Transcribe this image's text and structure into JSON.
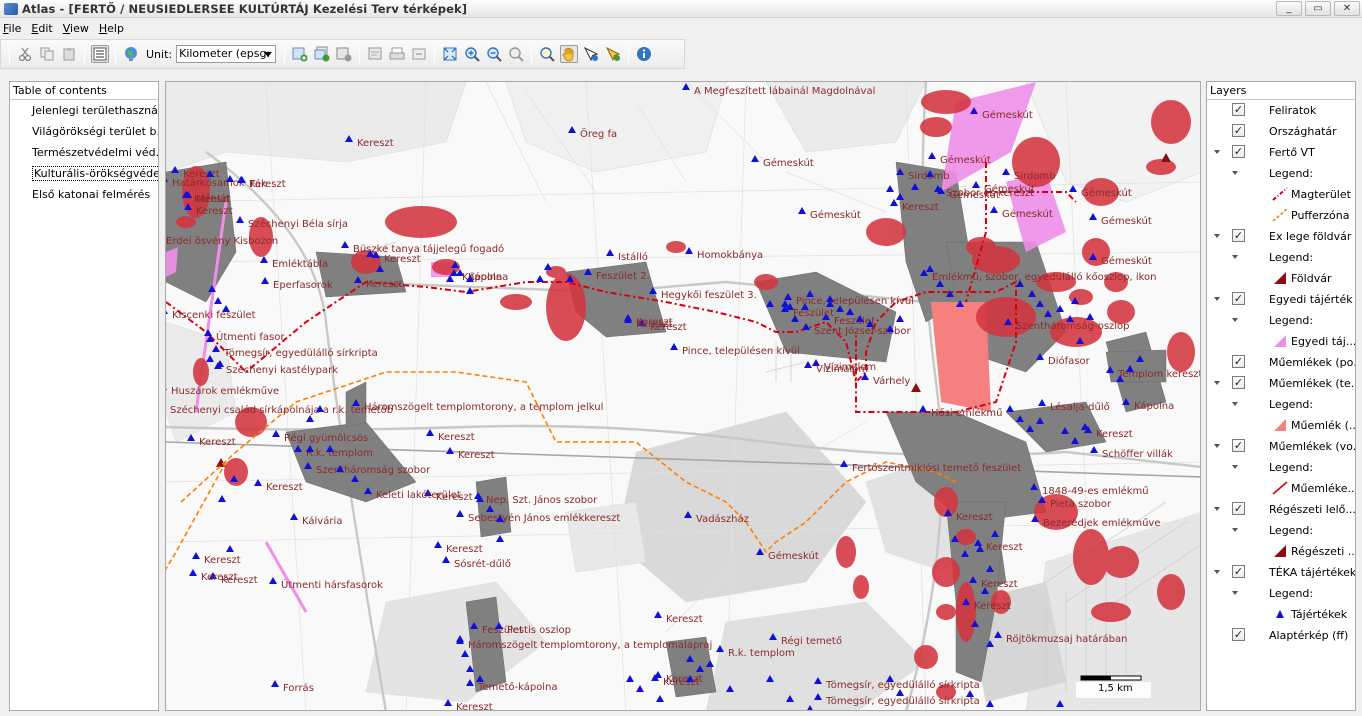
{
  "window": {
    "title": "Atlas - [FERTŐ / NEUSIEDLERSEE KULTÚRTÁJ Kezelési Terv térképek]",
    "controls": [
      "_",
      "▭",
      "✕"
    ]
  },
  "menu": [
    "File",
    "Edit",
    "View",
    "Help"
  ],
  "toolbar": {
    "unit_label": "Unit:",
    "unit_value": "Kilometer (epsg:"
  },
  "toc": {
    "title": "Table of contents",
    "items": [
      "Jelenlegi területhaszná...",
      "Világörökségi terület  b...",
      "Természetvédelmi véd...",
      "Kulturális-örökségvédelem",
      "Első katonai felmérés"
    ],
    "selected_index": 3
  },
  "layers": {
    "title": "Layers",
    "rows": [
      {
        "kind": "layer",
        "name": "Feliratok",
        "expandable": false
      },
      {
        "kind": "layer",
        "name": "Országhatár",
        "expandable": false
      },
      {
        "kind": "layer",
        "name": "Fertő VT",
        "expandable": true
      },
      {
        "kind": "legend",
        "name": "Legend:"
      },
      {
        "kind": "item",
        "name": "Magterület",
        "symbol": "dashdot-red"
      },
      {
        "kind": "item",
        "name": "Pufferzóna",
        "symbol": "dash-orange"
      },
      {
        "kind": "layer",
        "name": "Ex lege földvár",
        "expandable": true
      },
      {
        "kind": "legend",
        "name": "Legend:"
      },
      {
        "kind": "item",
        "name": "Földvár",
        "symbol": "tri-darkred"
      },
      {
        "kind": "layer",
        "name": "Egyedi tájérték",
        "expandable": true
      },
      {
        "kind": "legend",
        "name": "Legend:"
      },
      {
        "kind": "item",
        "name": "Egyedi táj...",
        "symbol": "tri-pink"
      },
      {
        "kind": "layer",
        "name": "Műemlékek (po...",
        "expandable": false
      },
      {
        "kind": "layer",
        "name": "Műemlékek (te...",
        "expandable": true
      },
      {
        "kind": "legend",
        "name": "Legend:"
      },
      {
        "kind": "item",
        "name": "Műemlék (...",
        "symbol": "tri-salmon"
      },
      {
        "kind": "layer",
        "name": "Műemlékek (vo...",
        "expandable": true
      },
      {
        "kind": "legend",
        "name": "Legend:"
      },
      {
        "kind": "item",
        "name": "Műemléke...",
        "symbol": "line-red"
      },
      {
        "kind": "layer",
        "name": "Régészeti lelő...",
        "expandable": true
      },
      {
        "kind": "legend",
        "name": "Legend:"
      },
      {
        "kind": "item",
        "name": "Régészeti ...",
        "symbol": "tri-darkred"
      },
      {
        "kind": "layer",
        "name": "TÉKA tájértékek",
        "expandable": true
      },
      {
        "kind": "legend",
        "name": "Legend:"
      },
      {
        "kind": "item",
        "name": "Tájértékek",
        "symbol": "point-blue"
      },
      {
        "kind": "layer",
        "name": "Alaptérkép (ff)",
        "expandable": false
      }
    ]
  },
  "map": {
    "scale_label": "1,5 km",
    "labels": [
      "A Megfeszített lábainál Magdolnával",
      "Öreg fa",
      "Gémeskút",
      "Gémeskút",
      "Gémeskút",
      "Gémeskút",
      "Gémeskút",
      "Gémeskút",
      "Gémeskút",
      "Gémeskút",
      "Gémeskút",
      "Gémeskút",
      "Gémeskút",
      "Sírdomb",
      "Sírdomb",
      "Szobor és kereszt",
      "Kereszt",
      "Kereszt",
      "Kereszt",
      "Kereszt",
      "Kereszt",
      "Kereszt",
      "Kereszt",
      "Kereszt",
      "Kereszt",
      "Kereszt",
      "Kereszt",
      "Kereszt",
      "Kereszt",
      "Kereszt",
      "Kereszt",
      "Kereszt",
      "Kereszt",
      "Kereszt",
      "Kereszt",
      "Kereszt",
      "Kereszt",
      "Kereszt",
      "Kereszt",
      "Kereszt",
      "Kereszt",
      "Kereszt",
      "Kereszt",
      "Kereszt",
      "Kereszt",
      "Határkősamok",
      "Fák",
      "Méhlát",
      "Széchenyi Béla sírja",
      "Erdei ösvény Kisbozon",
      "Büszke tanya tájjelegű fogadó",
      "Homokbánya",
      "Emléktábla",
      "Kápolna",
      "Kápolna",
      "Istálló",
      "Eperfasorok",
      "Kiscenki feszület",
      "Útmenti fasor",
      "Tömegsír, egyedülálló sírkripta",
      "Széchenyi kastélypark",
      "Huszárok emlékműve",
      "Széchenyi család sírkápolnája a r.k. temetőben",
      "Háromszögelt templomtorony, a templom jelkulccsal ábrázolva",
      "Régi gyümölcsös",
      "R.k. templom",
      "Szentháromság szobor",
      "Keleti lakóterület",
      "Kálvária",
      "Nep. Szt. János szobor",
      "Sebestyén János emlékkereszt",
      "Sósrét-dűlő",
      "Vadászház",
      "Útmenti hársfasorok",
      "Forrás",
      "Feszület",
      "Feszület 2.",
      "Hegykői feszület 3.",
      "Pince, településen kívül",
      "Pince, településen kívül",
      "Feszület",
      "Feszület",
      "Szent József-szobor",
      "Vízimalom",
      "Vízimalom",
      "Várhely",
      "Emlékmű, szobor, egyedülálló kőoszlop, ikon magasság oszlop",
      "Szentháromság-oszlop",
      "Diófasor",
      "Templom kereszt",
      "Lésalja-dűlő",
      "Kápolna",
      "Hősi emlékmű",
      "Fertőszentmiklósi temető feszület",
      "Schöffer villák",
      "1848-49-es emlékmű",
      "Pietà szobor",
      "Bezerédjek emlékműve",
      "Pestis oszlop",
      "Háromszögelt templomtorony, a templomalaprajzzal ábrázolva",
      "R.k. templom",
      "Temető-kápolna",
      "Régi temető",
      "Röjtökmuzsaj határában",
      "Tömegsír, egyedülálló sírkripta",
      "Tömegsír, egyedülálló sírkripta"
    ]
  },
  "colors": {
    "core_zone": "#d4000e",
    "buffer_zone": "#ff7f00",
    "archaeology": "#d4363f",
    "unique_value": "#f08ee8",
    "monument_area": "#f58080",
    "settlement": "#7f7f7f",
    "point": "#1010d8",
    "label": "#8b2a2a"
  }
}
